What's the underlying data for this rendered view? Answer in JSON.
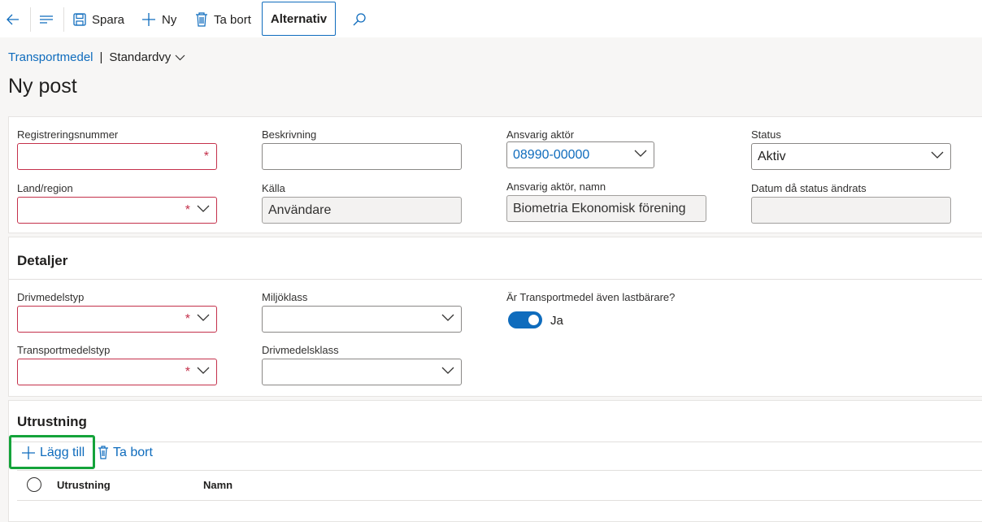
{
  "toolbar": {
    "save_label": "Spara",
    "new_label": "Ny",
    "delete_label": "Ta bort",
    "options_label": "Alternativ"
  },
  "breadcrumb": {
    "module": "Transportmedel",
    "separator": "|",
    "view": "Standardvy"
  },
  "page_title": "Ny post",
  "general": {
    "reg_number": {
      "label": "Registreringsnummer",
      "value": ""
    },
    "description": {
      "label": "Beskrivning",
      "value": ""
    },
    "responsible_actor": {
      "label": "Ansvarig aktör",
      "value": "08990-00000"
    },
    "status": {
      "label": "Status",
      "value": "Aktiv"
    },
    "country": {
      "label": "Land/region",
      "value": ""
    },
    "source": {
      "label": "Källa",
      "value": "Användare"
    },
    "actor_name": {
      "label": "Ansvarig aktör, namn",
      "value": "Biometria Ekonomisk förening"
    },
    "status_date": {
      "label": "Datum då status ändrats",
      "value": ""
    }
  },
  "details": {
    "title": "Detaljer",
    "fuel_type": {
      "label": "Drivmedelstyp",
      "value": ""
    },
    "env_class": {
      "label": "Miljöklass",
      "value": ""
    },
    "is_carrier": {
      "label": "Är Transportmedel även lastbärare?",
      "value": "Ja",
      "on": true
    },
    "vehicle_type": {
      "label": "Transportmedelstyp",
      "value": ""
    },
    "fuel_class": {
      "label": "Drivmedelsklass",
      "value": ""
    }
  },
  "equipment": {
    "title": "Utrustning",
    "add_label": "Lägg till",
    "delete_label": "Ta bort",
    "columns": [
      "Utrustning",
      "Namn"
    ]
  },
  "colors": {
    "accent": "#0f6cbd",
    "required": "#c4314b",
    "highlight": "#14a33a"
  }
}
